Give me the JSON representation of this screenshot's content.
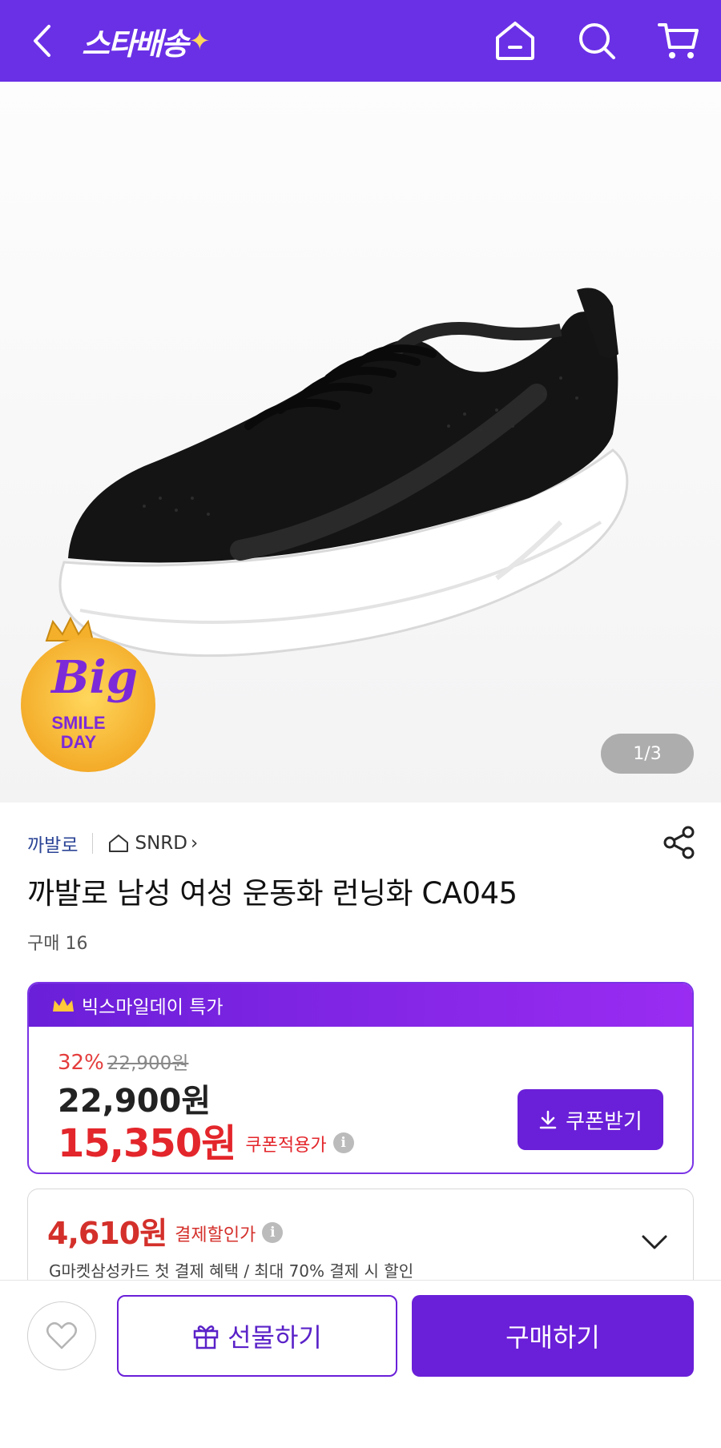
{
  "header": {
    "logo_text": "스타배송",
    "logo_spark": "✦",
    "bg_color": "#6a30e6"
  },
  "hero": {
    "page_indicator": "1/3",
    "badge": {
      "line1": "Big",
      "line2": "SMILE",
      "line3": "DAY"
    }
  },
  "product": {
    "brand": "까발로",
    "store": "SNRD",
    "store_chevron": "›",
    "title": "까발로 남성 여성 운동화 런닝화 CA045",
    "sold_count": "구매 16"
  },
  "price": {
    "event_label": "빅스마일데이 특가",
    "discount_pct": "32%",
    "original_price": "22,900원",
    "sale_price": "22,900원",
    "coupon_price": "15,350원",
    "coupon_label": "쿠폰적용가",
    "info": "i",
    "coupon_button": "쿠폰받기"
  },
  "card_discount": {
    "price": "4,610원",
    "label": "결제할인가",
    "info": "i",
    "description": "G마켓삼성카드 첫 결제 혜택 / 최대 70% 결제 시 할인"
  },
  "bottom": {
    "gift_button": "선물하기",
    "buy_button": "구매하기"
  },
  "colors": {
    "accent": "#6a1fd8",
    "price_red": "#e3262b",
    "brand_blue": "#2c4596"
  }
}
